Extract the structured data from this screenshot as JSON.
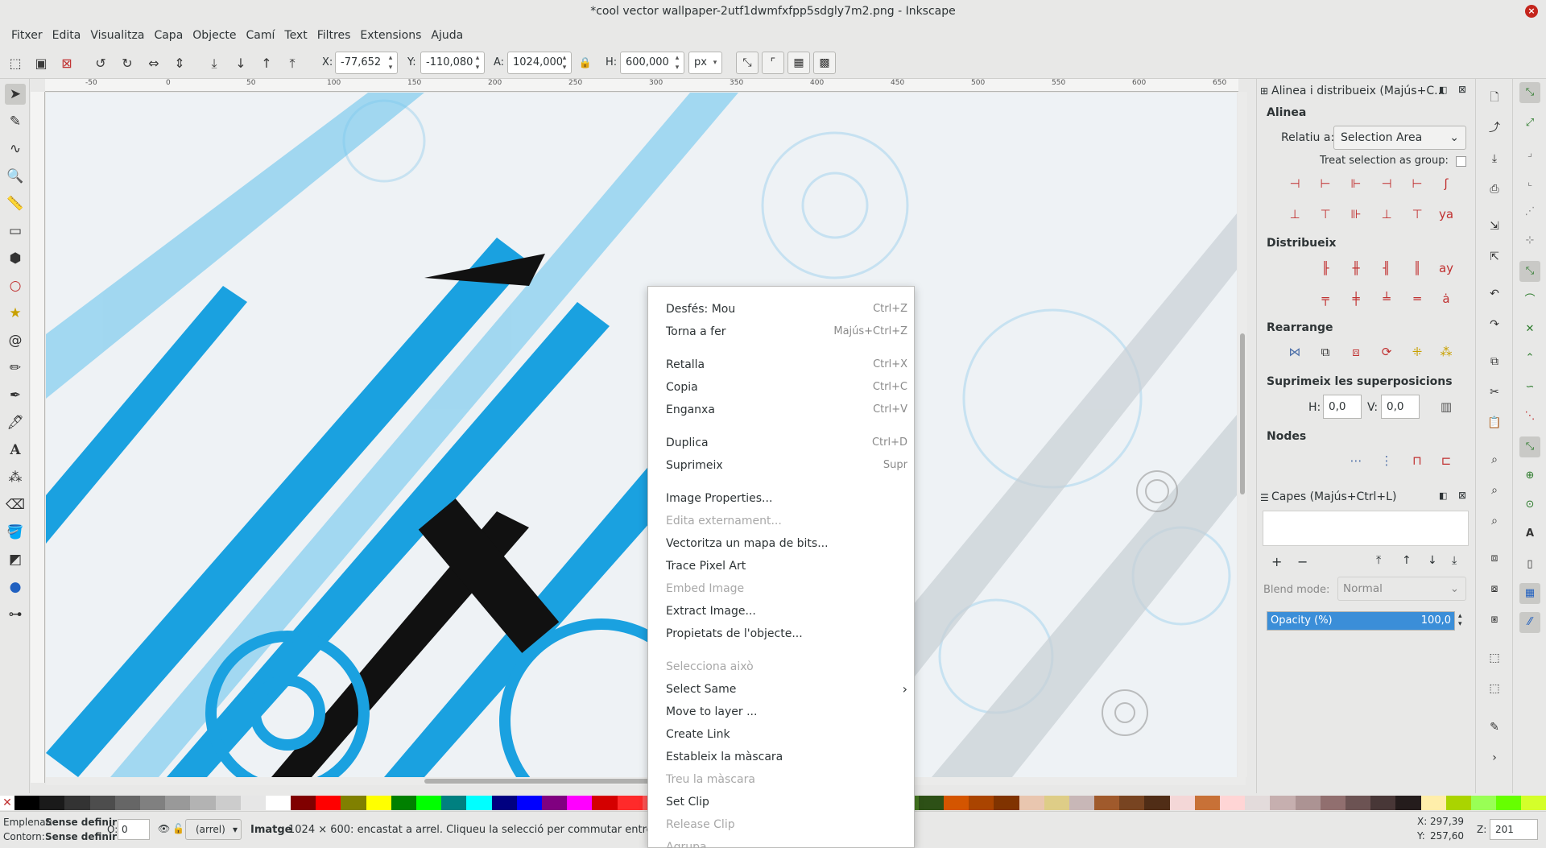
{
  "window": {
    "title": "*cool vector wallpaper-2utf1dwmfxfpp5sdgly7m2.png - Inkscape",
    "close_glyph": "×"
  },
  "menubar": [
    "Fitxer",
    "Edita",
    "Visualitza",
    "Capa",
    "Objecte",
    "Camí",
    "Text",
    "Filtres",
    "Extensions",
    "Ajuda"
  ],
  "toolbar": {
    "x_label": "X:",
    "x_value": "-77,652",
    "y_label": "Y:",
    "y_value": "-110,080",
    "w_label": "A:",
    "w_value": "1024,000",
    "h_label": "H:",
    "h_value": "600,000",
    "unit": "px"
  },
  "ruler_ticks": [
    "-50",
    "0",
    "50",
    "100",
    "150",
    "200",
    "250",
    "300",
    "350",
    "400",
    "450",
    "500",
    "550",
    "600",
    "650"
  ],
  "align_panel": {
    "title": "Alinea i distribueix (Majús+C...",
    "align_heading": "Alinea",
    "relative_label": "Relatiu a:",
    "relative_value": "Selection Area",
    "treat_group_label": "Treat selection as group:",
    "distribute_heading": "Distribueix",
    "rearrange_heading": "Rearrange",
    "overlaps_heading": "Suprimeix les superposicions",
    "overlap_h_label": "H:",
    "overlap_h_value": "0,0",
    "overlap_v_label": "V:",
    "overlap_v_value": "0,0",
    "nodes_heading": "Nodes"
  },
  "layers_panel": {
    "title": "Capes (Majús+Ctrl+L)",
    "blend_label": "Blend mode:",
    "blend_value": "Normal",
    "opacity_label": "Opacity (%)",
    "opacity_value": "100,0",
    "opacity_fraction": 1.0
  },
  "context_menu": {
    "items": [
      {
        "label": "Desfés: Mou",
        "shortcut": "Ctrl+Z",
        "disabled": false
      },
      {
        "label": "Torna a fer",
        "shortcut": "Majús+Ctrl+Z",
        "disabled": false
      },
      {
        "label": "Retalla",
        "shortcut": "Ctrl+X",
        "disabled": false
      },
      {
        "label": "Copia",
        "shortcut": "Ctrl+C",
        "disabled": false
      },
      {
        "label": "Enganxa",
        "shortcut": "Ctrl+V",
        "disabled": false
      },
      {
        "label": "Duplica",
        "shortcut": "Ctrl+D",
        "disabled": false
      },
      {
        "label": "Suprimeix",
        "shortcut": "Supr",
        "disabled": false
      },
      {
        "label": "Image Properties...",
        "shortcut": "",
        "disabled": false
      },
      {
        "label": "Edita externament...",
        "shortcut": "",
        "disabled": true
      },
      {
        "label": "Vectoritza un mapa de bits...",
        "shortcut": "",
        "disabled": false
      },
      {
        "label": "Trace Pixel Art",
        "shortcut": "",
        "disabled": false
      },
      {
        "label": "Embed Image",
        "shortcut": "",
        "disabled": true
      },
      {
        "label": "Extract Image...",
        "shortcut": "",
        "disabled": false
      },
      {
        "label": "Propietats de l'objecte...",
        "shortcut": "",
        "disabled": false
      },
      {
        "label": "Selecciona això",
        "shortcut": "",
        "disabled": true
      },
      {
        "label": "Select Same",
        "shortcut": "›",
        "disabled": false
      },
      {
        "label": "Move to layer ...",
        "shortcut": "",
        "disabled": false
      },
      {
        "label": "Create Link",
        "shortcut": "",
        "disabled": false
      },
      {
        "label": "Estableix la màscara",
        "shortcut": "",
        "disabled": false
      },
      {
        "label": "Treu la màscara",
        "shortcut": "",
        "disabled": true
      },
      {
        "label": "Set Clip",
        "shortcut": "",
        "disabled": false
      },
      {
        "label": "Release Clip",
        "shortcut": "",
        "disabled": true
      },
      {
        "label": "Agrupa",
        "shortcut": "",
        "disabled": true
      }
    ]
  },
  "statusbar": {
    "fill_label": "Emplenat:",
    "fill_value": "Sense definir",
    "stroke_label": "Contorn:",
    "stroke_value": "Sense definir",
    "opacity_label": "O:",
    "opacity_value": "0",
    "layer_value": "(arrel)",
    "message_bold": "Imatge",
    "message": " 1024 × 600: encastat a arrel. Cliqueu la selecció per commutar entre",
    "x_label": "X:",
    "x_value": "297,39",
    "y_label": "Y:",
    "y_value": "257,60",
    "zoom_label": "Z:",
    "zoom_value": "201"
  },
  "palette": [
    "#000000",
    "#1a1a1a",
    "#333333",
    "#4d4d4d",
    "#666666",
    "#808080",
    "#999999",
    "#b3b3b3",
    "#cccccc",
    "#e6e6e6",
    "#ffffff",
    "#800000",
    "#ff0000",
    "#808000",
    "#ffff00",
    "#008000",
    "#00ff00",
    "#008080",
    "#00ffff",
    "#000080",
    "#0000ff",
    "#800080",
    "#ff00ff",
    "#d40000",
    "#ff2a2a",
    "#ff5555",
    "#ff8080",
    "#aa0000",
    "#550000",
    "#2b0000",
    "#ff6600",
    "#ffcc00",
    "#ffe680",
    "#ccff00",
    "#88aa00",
    "#447821",
    "#2d5016",
    "#d45500",
    "#aa4400",
    "#803300",
    "#e9c6af",
    "#decd87",
    "#c8b7b7",
    "#a05a2c",
    "#784421",
    "#502d16",
    "#f4d7d7",
    "#c87137",
    "#ffd5d5",
    "#e3dbdb",
    "#c6afaf",
    "#ac9393",
    "#916f6f",
    "#6c5353",
    "#483737",
    "#241c1c",
    "#ffeeaa",
    "#aad400",
    "#99ff55",
    "#66ff00",
    "#d4ff2a"
  ]
}
